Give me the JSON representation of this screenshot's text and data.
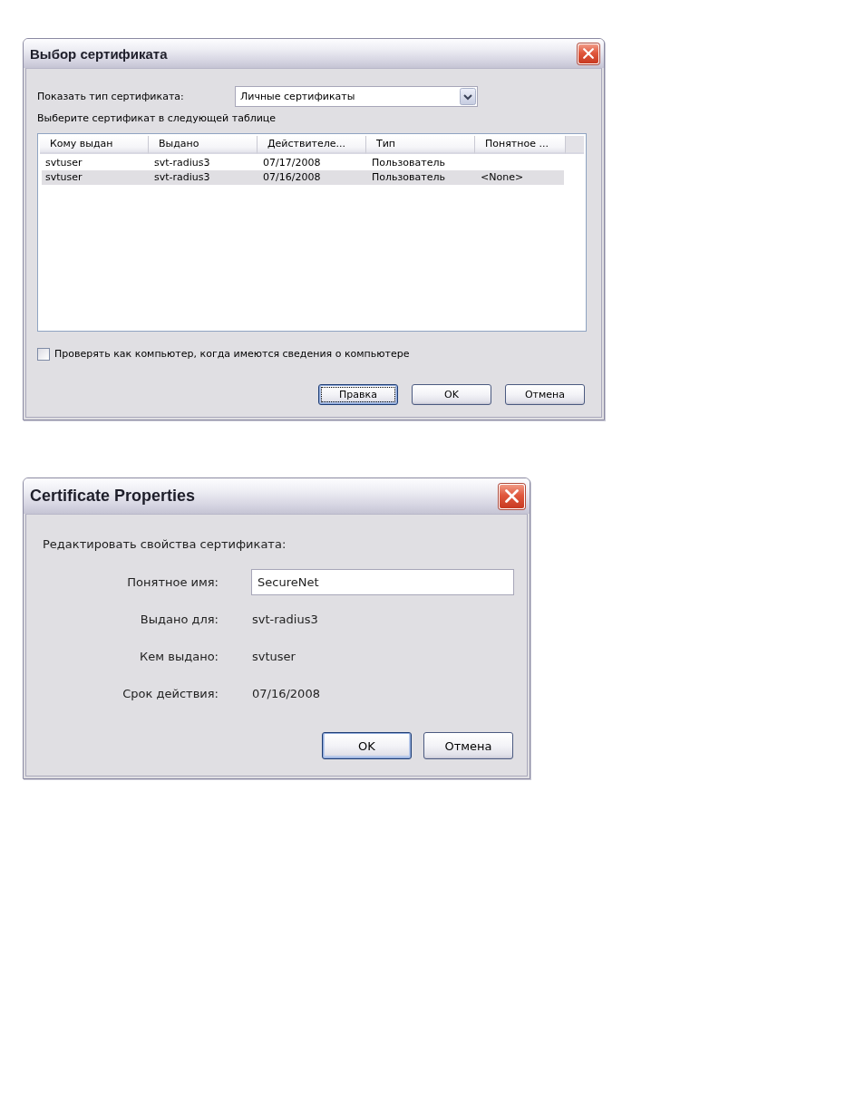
{
  "selection_dialog": {
    "title": "Выбор сертификата",
    "cert_type": {
      "label": "Показать тип сертификата:",
      "value": "Личные сертификаты"
    },
    "instruction": "Выберите сертификат в следующей таблице",
    "table": {
      "columns": [
        "Кому выдан",
        "Выдано",
        "Действителе...",
        "Тип",
        "Понятное ..."
      ],
      "rows": [
        {
          "cells": [
            "svtuser",
            "svt-radius3",
            "07/17/2008",
            "Пользователь"
          ],
          "selected": false
        },
        {
          "cells": [
            "svtuser",
            "svt-radius3",
            "07/16/2008",
            "Пользователь",
            "<None>"
          ],
          "selected": true
        }
      ]
    },
    "checkbox": {
      "label": "Проверять как компьютер, когда имеются сведения о компьютере",
      "checked": false
    },
    "buttons": [
      {
        "label": "Правка",
        "default": true,
        "focused": true
      },
      {
        "label": "OK",
        "default": false,
        "focused": false
      },
      {
        "label": "Отмена",
        "default": false,
        "focused": false
      }
    ]
  },
  "properties_dialog": {
    "title": "Certificate Properties",
    "heading": "Редактировать свойства сертификата:",
    "fields": [
      {
        "kind": "input",
        "label": "Понятное имя:",
        "value": "SecureNet"
      },
      {
        "kind": "text",
        "label": "Выдано для:",
        "value": "svt-radius3"
      },
      {
        "kind": "text",
        "label": "Кем выдано:",
        "value": "svtuser"
      },
      {
        "kind": "text",
        "label": "Срок действия:",
        "value": "07/16/2008"
      }
    ],
    "buttons": [
      {
        "label": "OK",
        "default": true,
        "focused": false
      },
      {
        "label": "Отмена",
        "default": false,
        "focused": false
      }
    ]
  }
}
